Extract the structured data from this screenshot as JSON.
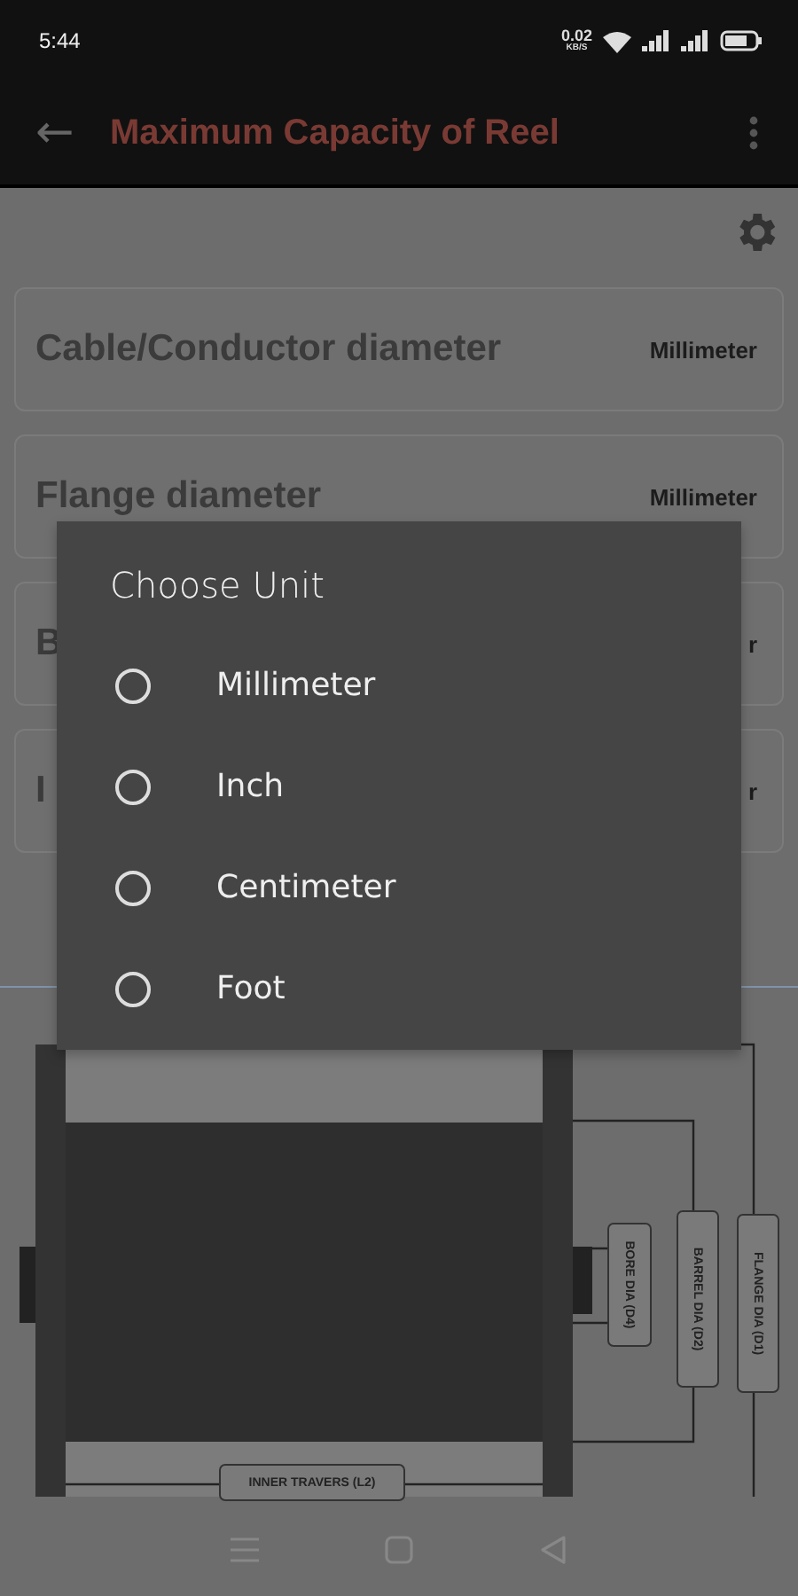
{
  "status_bar": {
    "time": "5:44",
    "net_speed": "0.02",
    "net_unit": "KB/S"
  },
  "toolbar": {
    "back": "←",
    "title": "Maximum Capacity of Reel"
  },
  "fields": [
    {
      "label": "Cable/Conductor diameter",
      "unit": "Millimeter"
    },
    {
      "label": "Flange diameter",
      "unit": "Millimeter"
    },
    {
      "label": "B",
      "unit": "r"
    },
    {
      "label": "I",
      "unit": "r"
    }
  ],
  "diagram": {
    "labels": [
      "BORE DIA (D4)",
      "BARREL DIA (D2)",
      "FLANGE DIA (D1)",
      "INNER TRAVERS (L2)"
    ]
  },
  "dialog": {
    "title": "Choose Unit",
    "options": [
      {
        "label": "Millimeter",
        "selected": false
      },
      {
        "label": "Inch",
        "selected": false
      },
      {
        "label": "Centimeter",
        "selected": false
      },
      {
        "label": "Foot",
        "selected": false
      }
    ]
  }
}
